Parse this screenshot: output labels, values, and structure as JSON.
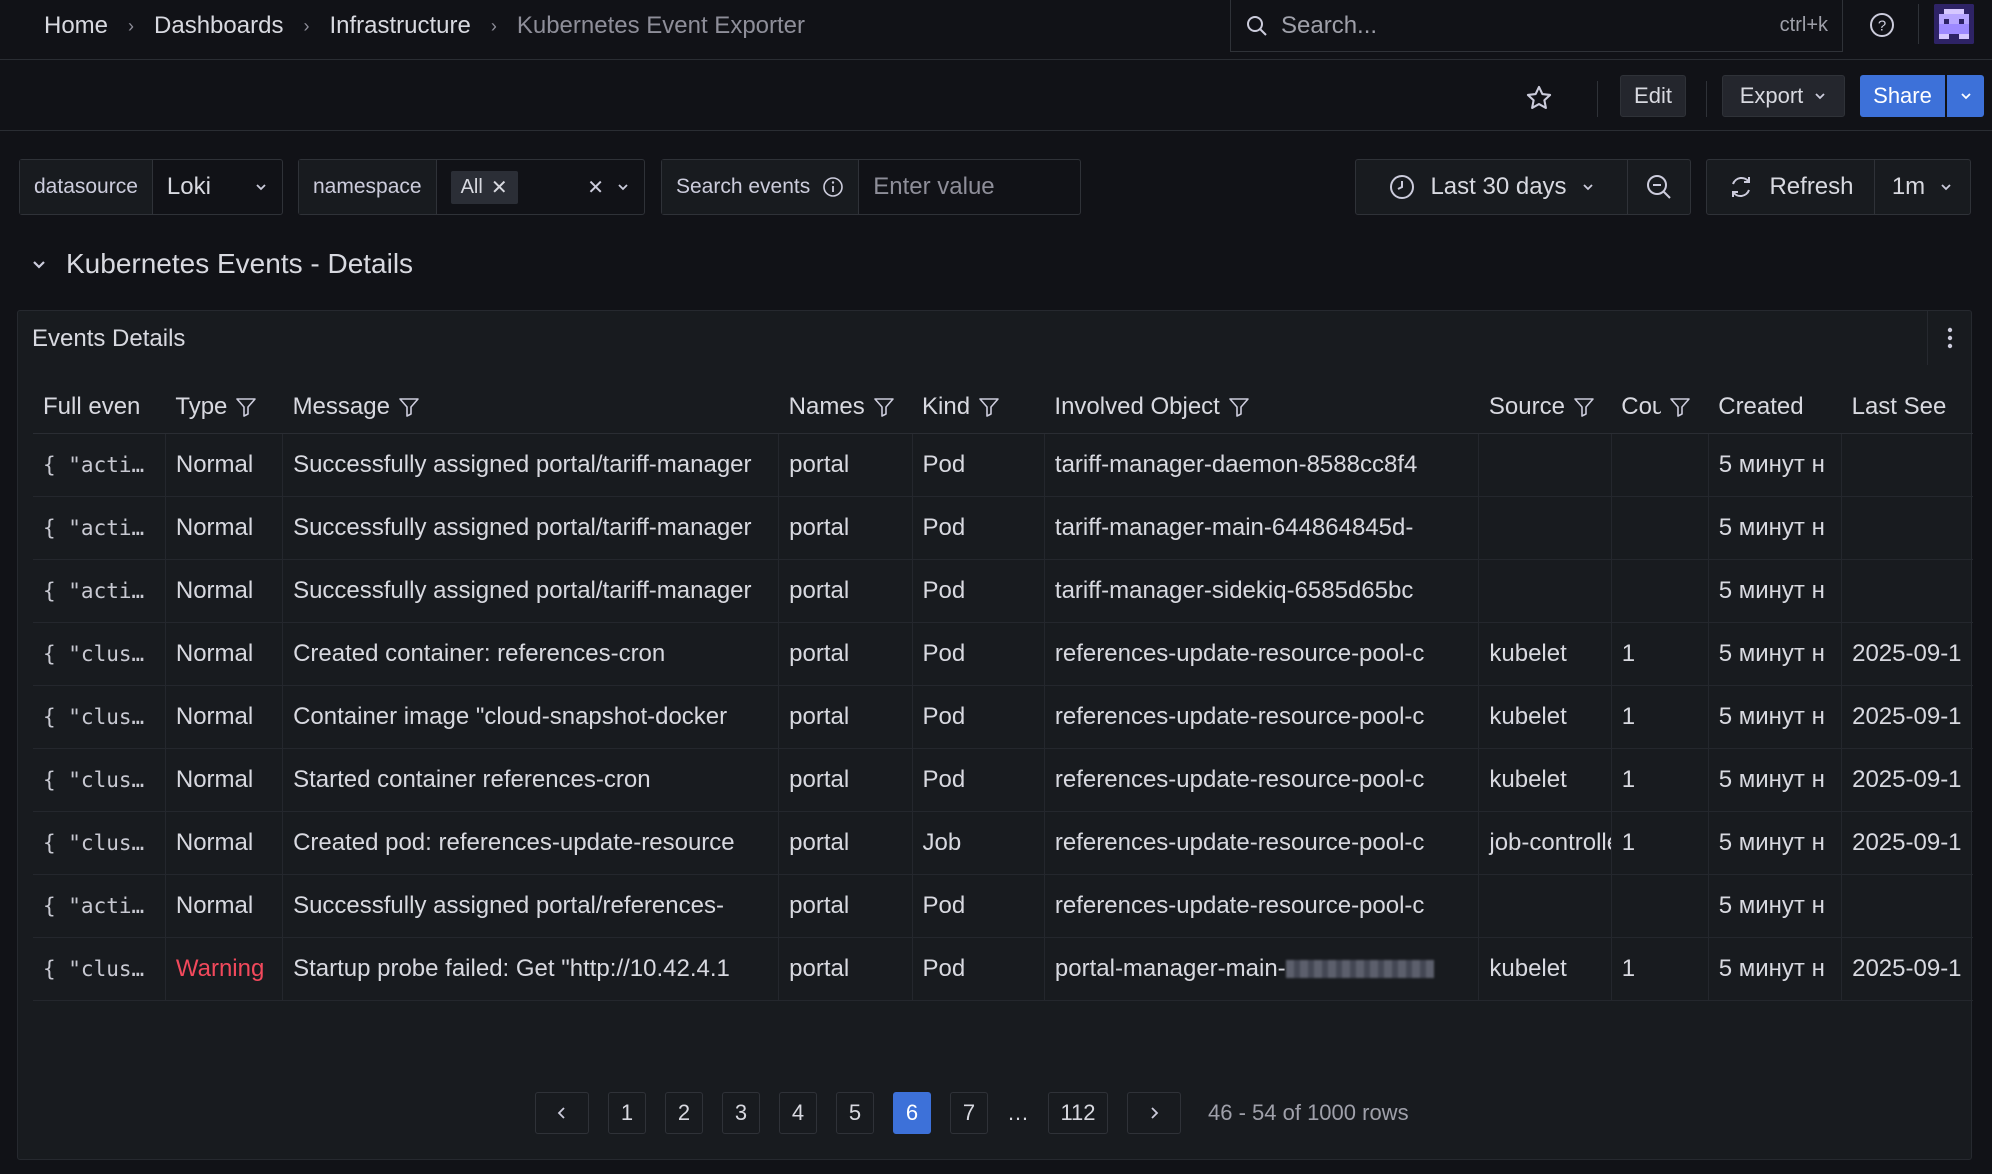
{
  "breadcrumb": [
    "Home",
    "Dashboards",
    "Infrastructure",
    "Kubernetes Event Exporter"
  ],
  "search": {
    "placeholder": "Search...",
    "shortcut": "ctrl+k"
  },
  "toolbar": {
    "edit": "Edit",
    "export": "Export",
    "share": "Share"
  },
  "variables": {
    "datasource": {
      "label": "datasource",
      "value": "Loki"
    },
    "namespace": {
      "label": "namespace",
      "value": "All"
    },
    "search_events": {
      "label": "Search events",
      "placeholder": "Enter value"
    }
  },
  "time_range": {
    "label": "Last 30 days"
  },
  "refresh": {
    "label": "Refresh",
    "interval": "1m"
  },
  "row": {
    "title": "Kubernetes Events - Details"
  },
  "panel": {
    "title": "Events Details",
    "columns": [
      "Full even",
      "Type",
      "Message",
      "Names",
      "Kind",
      "Involved Object",
      "Source",
      "Cou",
      "Created",
      "Last See"
    ],
    "rows": [
      [
        "{ \"action\"",
        "Normal",
        "Successfully assigned portal/tariff-manager",
        "portal",
        "Pod",
        "tariff-manager-daemon-8588cc8f4",
        "",
        "",
        "5 минут н",
        ""
      ],
      [
        "{ \"action\"",
        "Normal",
        "Successfully assigned portal/tariff-manager",
        "portal",
        "Pod",
        "tariff-manager-main-644864845d-",
        "",
        "",
        "5 минут н",
        ""
      ],
      [
        "{ \"action\"",
        "Normal",
        "Successfully assigned portal/tariff-manager",
        "portal",
        "Pod",
        "tariff-manager-sidekiq-6585d65bc",
        "",
        "",
        "5 минут н",
        ""
      ],
      [
        "{ \"cluster\"",
        "Normal",
        "Created container: references-cron",
        "portal",
        "Pod",
        "references-update-resource-pool-c",
        "kubelet",
        "1",
        "5 минут н",
        "2025-09-1"
      ],
      [
        "{ \"cluster\"",
        "Normal",
        "Container image \"cloud-snapshot-docker",
        "portal",
        "Pod",
        "references-update-resource-pool-c",
        "kubelet",
        "1",
        "5 минут н",
        "2025-09-1"
      ],
      [
        "{ \"cluster\"",
        "Normal",
        "Started container references-cron",
        "portal",
        "Pod",
        "references-update-resource-pool-c",
        "kubelet",
        "1",
        "5 минут н",
        "2025-09-1"
      ],
      [
        "{ \"cluster\"",
        "Normal",
        "Created pod: references-update-resource",
        "portal",
        "Job",
        "references-update-resource-pool-c",
        "job-controller",
        "1",
        "5 минут н",
        "2025-09-1"
      ],
      [
        "{ \"action\"",
        "Normal",
        "Successfully assigned portal/references-",
        "portal",
        "Pod",
        "references-update-resource-pool-c",
        "",
        "",
        "5 минут н",
        ""
      ],
      [
        "{ \"cluster\"",
        "Warning",
        "Startup probe failed: Get \"http://10.42.4.1",
        "portal",
        "Pod",
        "portal-manager-main-",
        "kubelet",
        "1",
        "5 минут н",
        "2025-09-1"
      ]
    ]
  },
  "pagination": {
    "pages": [
      "1",
      "2",
      "3",
      "4",
      "5",
      "6",
      "7",
      "…",
      "112"
    ],
    "current": "6",
    "summary": "46 - 54 of 1000 rows"
  },
  "colors": {
    "accent": "#3d71d9",
    "warning": "#f2495c",
    "background": "#111217",
    "panel": "#181b1f"
  }
}
